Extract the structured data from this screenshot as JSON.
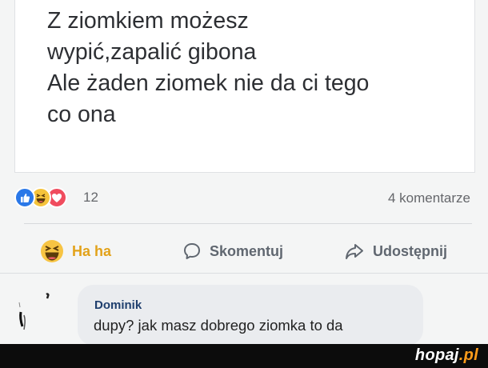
{
  "post": {
    "lines": [
      "Z ziomkiem  możesz",
      "wypić,zapalić gibona",
      "Ale żaden ziomek nie da ci tego",
      "co ona"
    ]
  },
  "reactions": {
    "icons": [
      "like-icon",
      "haha-icon",
      "love-icon"
    ],
    "count": "12",
    "comments_count": "4 komentarze"
  },
  "actions": {
    "haha_label": "Ha ha",
    "comment_label": "Skomentuj",
    "share_label": "Udostępnij"
  },
  "comment": {
    "author": "Dominik",
    "text": "dupy? jak masz dobrego ziomka to da"
  },
  "watermark": {
    "text": "hopaj",
    "suffix": ".pl"
  },
  "colors": {
    "like_blue": "#2a78e8",
    "haha_yellow": "#f5c33b",
    "love_red": "#f04c5e",
    "watermark_accent": "#ff9c1a"
  }
}
